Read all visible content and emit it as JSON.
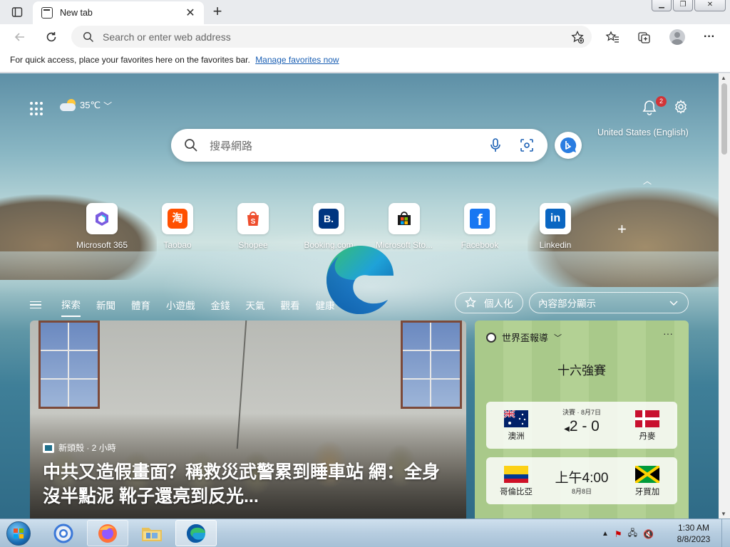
{
  "browser": {
    "tab_title": "New tab",
    "address_placeholder": "Search or enter web address",
    "favorites_bar": {
      "message": "For quick access, place your favorites here on the favorites bar.",
      "link": "Manage favorites now"
    }
  },
  "newtab": {
    "weather_temp": "35℃",
    "notification_count": "2",
    "language": "United States (English)",
    "search_placeholder": "搜尋網路",
    "quick_links": [
      {
        "label": "Microsoft 365"
      },
      {
        "label": "Taobao"
      },
      {
        "label": "Shopee"
      },
      {
        "label": "Booking.com"
      },
      {
        "label": "Microsoft Sto..."
      },
      {
        "label": "Facebook"
      },
      {
        "label": "Linkedin"
      }
    ],
    "feed_tabs": [
      "探索",
      "新聞",
      "體育",
      "小遊戲",
      "金錢",
      "天氣",
      "觀看",
      "健康"
    ],
    "personalize_label": "個人化",
    "view_select": "內容部分顯示",
    "news": {
      "source": "新頭殼 · 2 小時",
      "headline": "中共又造假畫面？稱救災武警累到睡車站 網：全身沒半點泥 靴子還亮到反光..."
    },
    "sports": {
      "title": "世界盃報導",
      "round": "十六強賽",
      "matches": [
        {
          "team1": "澳洲",
          "team2": "丹麥",
          "info": "決賽 · 8月7日",
          "result": "2 - 0"
        },
        {
          "team1": "哥倫比亞",
          "team2": "牙買加",
          "info": "8月8日",
          "result": "上午4:00"
        }
      ]
    }
  },
  "taskbar": {
    "time": "1:30 AM",
    "date": "8/8/2023"
  }
}
